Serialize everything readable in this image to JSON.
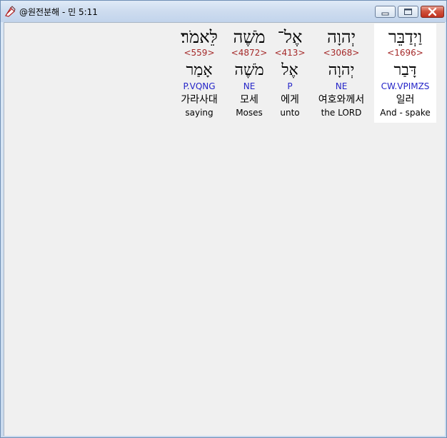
{
  "window": {
    "title": "@원전분해 - 민 5:11",
    "icon": "app-icon",
    "buttons": {
      "minimize": "minimize-icon",
      "maximize": "maximize-icon",
      "close": "close-icon"
    }
  },
  "words": [
    {
      "hebrew": "וַיְדַבֵּר",
      "strong": "<1696>",
      "lemma": "דָּבַר",
      "parsing": "CW.VPIMZS",
      "korean": "일러",
      "english": "And - spake"
    },
    {
      "hebrew": "יְהוָה",
      "strong": "<3068>",
      "lemma": "יְהוָה",
      "parsing": "NE",
      "korean": "여호와께서",
      "english": "the LORD"
    },
    {
      "hebrew": "אֶל־",
      "strong": "<413>",
      "lemma": "אֶל",
      "parsing": "P",
      "korean": "에게",
      "english": "unto"
    },
    {
      "hebrew": "מֹשֶׁה",
      "strong": "<4872>",
      "lemma": "מֹשֶׁה",
      "parsing": "NE",
      "korean": "모세",
      "english": "Moses"
    },
    {
      "hebrew": "לֵּאמֹר׃",
      "strong": "<559>",
      "lemma": "אָמַר",
      "parsing": "P.VQNG",
      "korean": "가라사대",
      "english": "saying"
    }
  ]
}
